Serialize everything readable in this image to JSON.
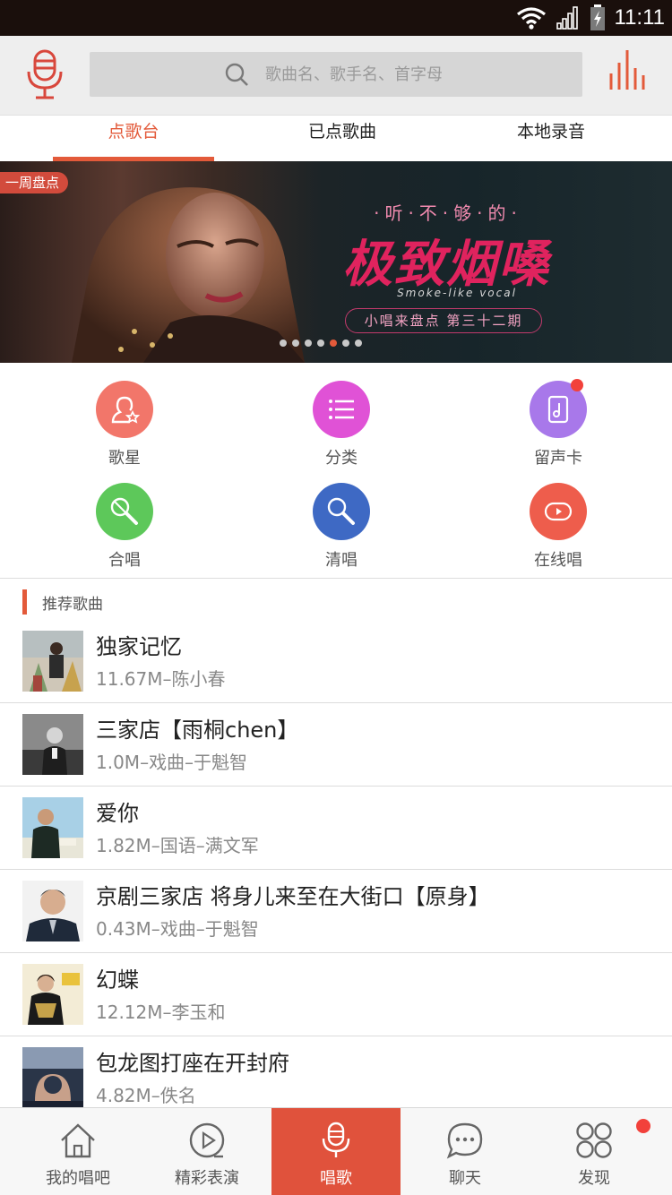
{
  "status_bar": {
    "time": "11:11"
  },
  "header": {
    "search_placeholder": "歌曲名、歌手名、首字母"
  },
  "tabs": [
    {
      "label": "点歌台",
      "active": true
    },
    {
      "label": "已点歌曲",
      "active": false
    },
    {
      "label": "本地录音",
      "active": false
    }
  ],
  "banner": {
    "badge": "一周盘点",
    "kicker": "·听·不·够·的·",
    "title": "极致烟嗓",
    "subtitle": "Smoke-like vocal",
    "pill": "小唱来盘点 第三十二期",
    "active_slide": 5,
    "slide_count": 7
  },
  "categories": [
    {
      "label": "歌星",
      "icon": "singer-star-icon",
      "color": "#f2766a"
    },
    {
      "label": "分类",
      "icon": "list-icon",
      "color": "#e052d6"
    },
    {
      "label": "留声卡",
      "icon": "music-card-icon",
      "color": "#a878ea",
      "badge": true
    },
    {
      "label": "合唱",
      "icon": "duet-mic-icon",
      "color": "#5dc85a"
    },
    {
      "label": "清唱",
      "icon": "mic-icon",
      "color": "#3e69c4"
    },
    {
      "label": "在线唱",
      "icon": "play-screen-icon",
      "color": "#ee5d4c"
    }
  ],
  "section": {
    "title": "推荐歌曲"
  },
  "songs": [
    {
      "title": "独家记忆",
      "meta": "11.67M–陈小春"
    },
    {
      "title": "三家店【雨桐chen】",
      "meta": "1.0M–戏曲–于魁智"
    },
    {
      "title": "爱你",
      "meta": "1.82M–国语–满文军"
    },
    {
      "title": "京剧三家店 将身儿来至在大街口【原身】",
      "meta": "0.43M–戏曲–于魁智"
    },
    {
      "title": "幻蝶",
      "meta": "12.12M–李玉和"
    },
    {
      "title": "包龙图打座在开封府",
      "meta": "4.82M–佚名"
    }
  ],
  "bottom_nav": [
    {
      "label": "我的唱吧",
      "icon": "home-icon"
    },
    {
      "label": "精彩表演",
      "icon": "play-circle-icon"
    },
    {
      "label": "唱歌",
      "icon": "mic-icon",
      "active": true
    },
    {
      "label": "聊天",
      "icon": "chat-bubble-icon"
    },
    {
      "label": "发现",
      "icon": "grid-circles-icon",
      "badge": true
    }
  ],
  "colors": {
    "accent": "#e35a3a",
    "status_bar": "#1a0f0c",
    "header_bg": "#eeeeee"
  }
}
